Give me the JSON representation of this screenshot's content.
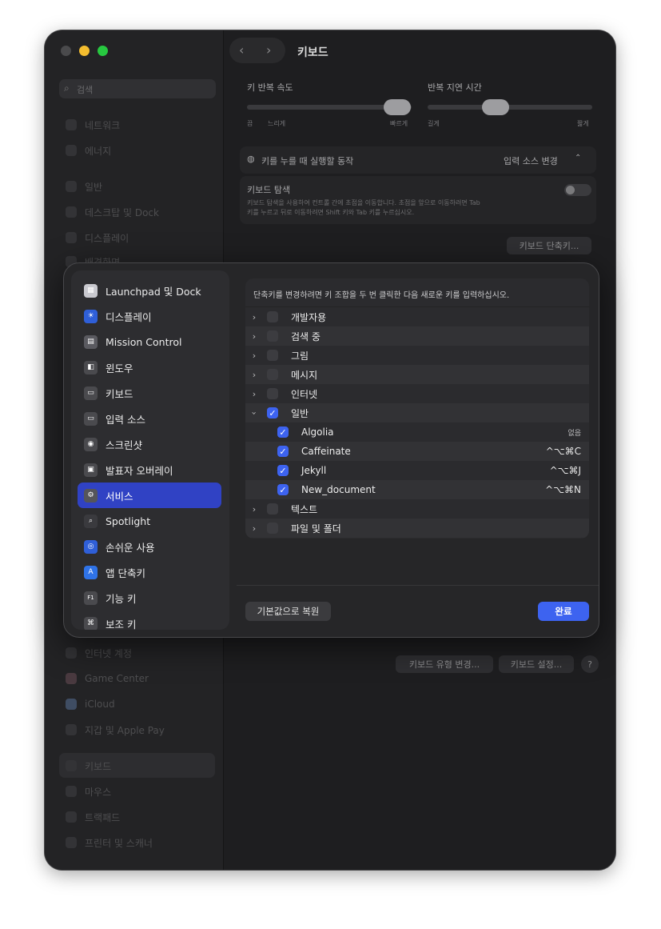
{
  "window": {
    "title": "키보드"
  },
  "background_sidebar": {
    "search_placeholder": "검색",
    "items_top": [
      "네트워크",
      "에너지",
      "일반",
      "데스크탑 및 Dock",
      "디스플레이",
      "배경화면"
    ],
    "items_bottom": [
      "인터넷 계정",
      "Game Center",
      "iCloud",
      "지갑 및 Apple Pay",
      "키보드",
      "마우스",
      "트랙패드",
      "프린터 및 스캐너"
    ]
  },
  "background_main": {
    "key_repeat_label": "키 반복 속도",
    "repeat_delay_label": "반복 지연 시간",
    "repeat_scale": {
      "off": "끔",
      "slow": "느리게",
      "fast": "빠르게"
    },
    "delay_scale": {
      "long": "길게",
      "short": "짧게"
    },
    "globe_action_label": "키를 누를 때 실행할 동작",
    "globe_action_value": "입력 소스 변경",
    "keyboard_nav_title": "키보드 탐색",
    "keyboard_nav_desc_1": "키보드 탐색을 사용하여 컨트롤 간에 초점을 이동합니다. 초점을 앞으로 이동하려면 Tab",
    "keyboard_nav_desc_2": "키를 누르고 뒤로 이동하려면 Shift 키와 Tab 키를 누르십시오.",
    "shortcuts_button": "키보드 단축키...",
    "change_type_button": "키보드 유형 변경...",
    "setup_button": "키보드 설정...",
    "help": "?"
  },
  "modal": {
    "sidebar": [
      {
        "label": "Launchpad 및 Dock",
        "icon": "launchpad-icon"
      },
      {
        "label": "디스플레이",
        "icon": "display-icon"
      },
      {
        "label": "Mission Control",
        "icon": "mission-control-icon"
      },
      {
        "label": "윈도우",
        "icon": "window-icon"
      },
      {
        "label": "키보드",
        "icon": "keyboard-icon"
      },
      {
        "label": "입력 소스",
        "icon": "input-source-icon"
      },
      {
        "label": "스크린샷",
        "icon": "screenshot-icon"
      },
      {
        "label": "발표자 오버레이",
        "icon": "presenter-overlay-icon"
      },
      {
        "label": "서비스",
        "icon": "services-icon",
        "selected": true
      },
      {
        "label": "Spotlight",
        "icon": "spotlight-icon"
      },
      {
        "label": "손쉬운 사용",
        "icon": "accessibility-icon"
      },
      {
        "label": "앱 단축키",
        "icon": "app-shortcuts-icon"
      },
      {
        "label": "기능 키",
        "icon": "function-keys-icon"
      },
      {
        "label": "보조 키",
        "icon": "modifier-keys-icon"
      }
    ],
    "instruction": "단축키를 변경하려면 키 조합을 두 번 클릭한 다음 새로운 키를 입력하십시오.",
    "rows": [
      {
        "label": "개발자용",
        "type": "group",
        "expanded": false,
        "checked": false
      },
      {
        "label": "검색 중",
        "type": "group",
        "expanded": false,
        "checked": false
      },
      {
        "label": "그림",
        "type": "group",
        "expanded": false,
        "checked": false
      },
      {
        "label": "메시지",
        "type": "group",
        "expanded": false,
        "checked": false
      },
      {
        "label": "인터넷",
        "type": "group",
        "expanded": false,
        "checked": false
      },
      {
        "label": "일반",
        "type": "group",
        "expanded": true,
        "checked": true
      },
      {
        "label": "Algolia",
        "type": "item",
        "checked": true,
        "shortcut": "없음"
      },
      {
        "label": "Caffeinate",
        "type": "item",
        "checked": true,
        "shortcut": "^⌥⌘C"
      },
      {
        "label": "Jekyll",
        "type": "item",
        "checked": true,
        "shortcut": "^⌥⌘J"
      },
      {
        "label": "New_document",
        "type": "item",
        "checked": true,
        "shortcut": "^⌥⌘N"
      },
      {
        "label": "텍스트",
        "type": "group",
        "expanded": false,
        "checked": false
      },
      {
        "label": "파일 및 폴더",
        "type": "group",
        "expanded": false,
        "checked": false
      }
    ],
    "reset_button": "기본값으로 복원",
    "done_button": "완료"
  },
  "colors": {
    "accent": "#3d63f0",
    "selection": "#3042c4",
    "window_bg": "#1e1e20"
  }
}
